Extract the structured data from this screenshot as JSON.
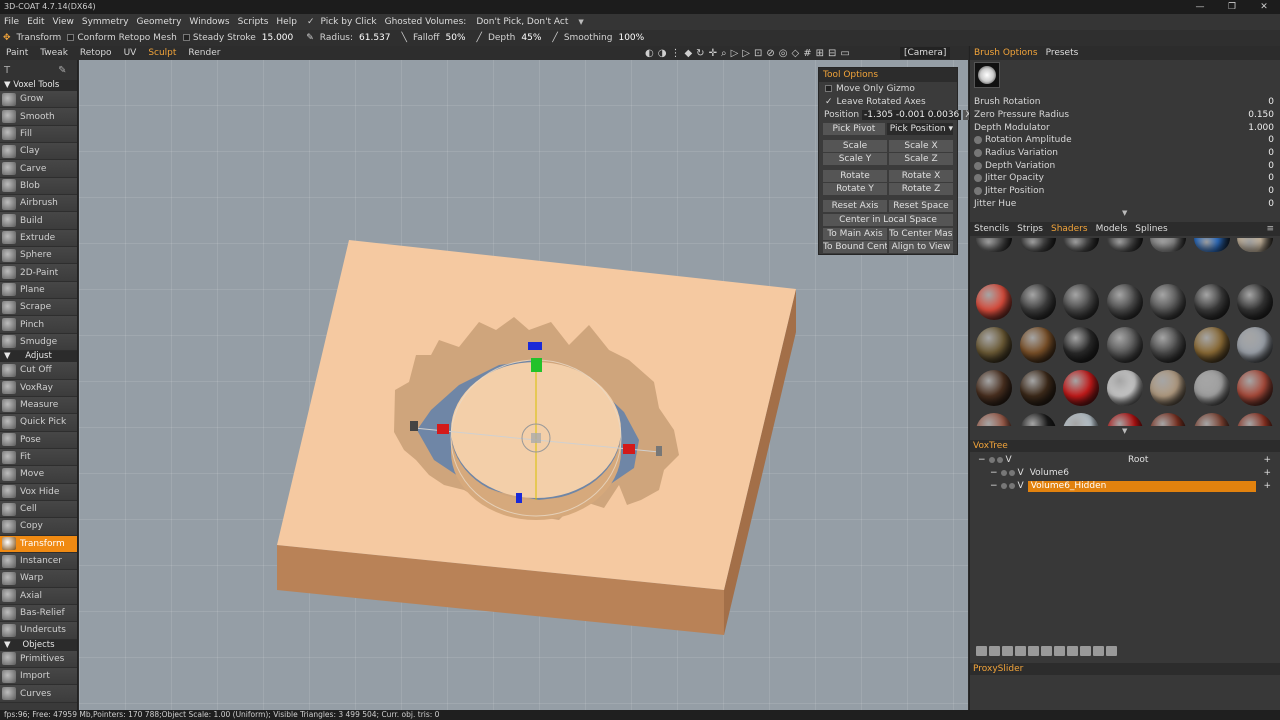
{
  "app": {
    "title": "3D-COAT 4.7.14(DX64)"
  },
  "window_controls": [
    "—",
    "❐",
    "✕"
  ],
  "menu": {
    "items": [
      "File",
      "Edit",
      "View",
      "Symmetry",
      "Geometry",
      "Windows",
      "Scripts",
      "Help"
    ],
    "pick_by_click": "Pick by Click",
    "ghosted_label": "Ghosted Volumes:",
    "ghosted_value": "Don't Pick, Don't Act"
  },
  "toolbar": {
    "transform": "Transform",
    "conform": "Conform Retopo Mesh",
    "steady_stroke": "Steady Stroke",
    "steady_stroke_value": "15.000",
    "radius_label": "Radius:",
    "radius_value": "61.537",
    "falloff_label": "Falloff",
    "falloff_value": "50%",
    "depth_label": "Depth",
    "depth_value": "45%",
    "smoothing_label": "Smoothing",
    "smoothing_value": "100%"
  },
  "rooms": {
    "items": [
      "Paint",
      "Tweak",
      "Retopo",
      "UV",
      "Sculpt",
      "Render"
    ],
    "active": "Sculpt",
    "camera": "[Camera]"
  },
  "left_panel": {
    "voxel_tools_header": "Voxel Tools",
    "voxel_tools": [
      "Grow",
      "Smooth",
      "Fill",
      "Clay",
      "Carve",
      "Blob",
      "Airbrush",
      "Build",
      "Extrude",
      "Sphere",
      "2D-Paint",
      "Plane",
      "Scrape",
      "Pinch",
      "Smudge"
    ],
    "adjust_header": "Adjust",
    "adjust_tools": [
      "Cut Off",
      "VoxRay",
      "Measure",
      "Quick Pick",
      "Pose",
      "Fit",
      "Move",
      "Vox Hide",
      "Cell",
      "Copy",
      "Transform",
      "Instancer",
      "Warp",
      "Axial",
      "Bas-Relief",
      "Undercuts"
    ],
    "active_tool": "Transform",
    "objects_header": "Objects",
    "objects_tools": [
      "Primitives",
      "Import",
      "Curves"
    ]
  },
  "tool_options": {
    "header": "Tool Options",
    "move_only_gizmo": "Move Only Gizmo",
    "leave_rotated_axes": "Leave Rotated Axes",
    "position_label": "Position",
    "position_value": "-1.305 -0.001 0.0036",
    "position_x": "X",
    "pick_pivot": "Pick Pivot",
    "pick_position": "Pick Position",
    "buttons": [
      "Scale",
      "Scale  X",
      "Scale  Y",
      "Scale  Z",
      "Rotate",
      "Rotate  X",
      "Rotate  Y",
      "Rotate  Z",
      "Reset Axis",
      "Reset Space"
    ],
    "center_local": "Center  in  Local Space",
    "to_main_axis": "To Main Axis",
    "to_center_mass": "To Center Mass",
    "to_bound_center": "To Bound Cente",
    "align_to_view": "Align to View"
  },
  "brush_options": {
    "tabs": [
      "Brush Options",
      "Presets"
    ],
    "rows": [
      {
        "label": "Brush Rotation",
        "value": "0"
      },
      {
        "label": "Zero Pressure Radius",
        "value": "0.150"
      },
      {
        "label": "Depth Modulator",
        "value": "1.000"
      },
      {
        "label": "Rotation Amplitude",
        "value": "0"
      },
      {
        "label": "Radius Variation",
        "value": "0"
      },
      {
        "label": "Depth Variation",
        "value": "0"
      },
      {
        "label": "Jitter Opacity",
        "value": "0"
      },
      {
        "label": "Jitter Position",
        "value": "0"
      },
      {
        "label": "Jitter Hue",
        "value": "0"
      }
    ]
  },
  "shaders": {
    "tabs": [
      "Stencils",
      "Strips",
      "Shaders",
      "Models",
      "Splines"
    ],
    "active_tab": "Shaders",
    "colors": [
      "#5a5a5a",
      "#4a4a4a",
      "#4d4d4d",
      "#505050",
      "#8a8a8a",
      "#2d6fc4",
      "#c9b8a0",
      "#d94c3c",
      "#3e3e3e",
      "#474747",
      "#4a4a4a",
      "#555555",
      "#3b3b3b",
      "#353535",
      "#6b5a35",
      "#7a5028",
      "#2a2a2a",
      "#585858",
      "#4a4a4a",
      "#8a6a35",
      "#9aa0a8",
      "#4a3020",
      "#3d2a1a",
      "#c41a1a",
      "#c8c8c8",
      "#b09a80",
      "#a0a0a0",
      "#a84a3a",
      "#9a5a48",
      "#1a1a1a",
      "#b8c4cc",
      "#b01010",
      "#7a3020",
      "#7a4030",
      "#8a3020"
    ]
  },
  "voxtree": {
    "header": "VoxTree",
    "root": "Root",
    "v": "V",
    "items": [
      "Volume6",
      "Volume6_Hidden"
    ],
    "selected": "Volume6_Hidden"
  },
  "proxy_slider": "ProxySlider",
  "status_bar": "fps:96;   Free: 47959 Mb,Pointers: 170 788;Object Scale: 1.00 (Uniform); Visible Triangles: 3 499 504; Curr. obj. tris: 0"
}
